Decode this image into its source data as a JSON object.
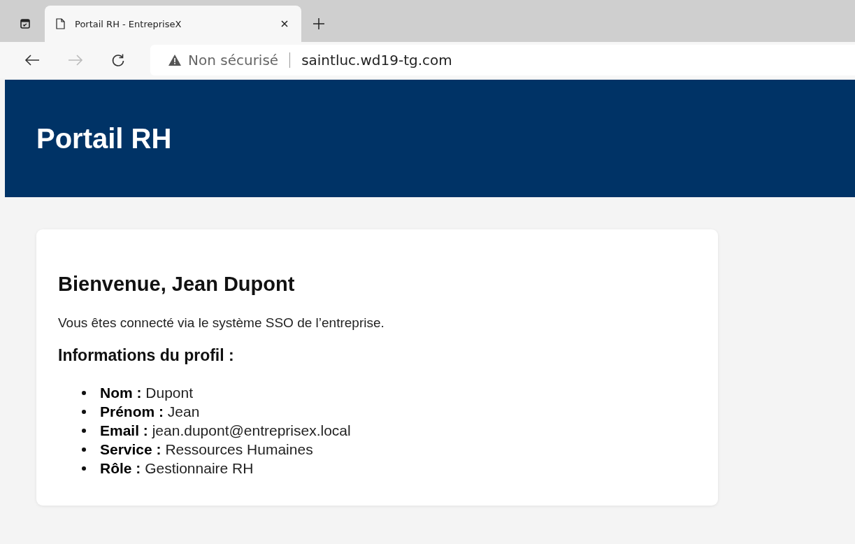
{
  "browser": {
    "tabs": [
      {
        "title": "Portail RH - EntrepriseX",
        "selected": true
      }
    ],
    "address_bar": {
      "security": "Non sécurisé",
      "url": "saintluc.wd19-tg.com"
    },
    "forward_disabled": true
  },
  "header": {
    "title": "Portail RH"
  },
  "card": {
    "heading": "Bienvenue, Jean Dupont",
    "intro": "Vous êtes connecté via le système SSO de l’entreprise.",
    "subheading": "Informations du profil :",
    "fields": [
      "**Nom :** Dupont",
      "**Prénom :** Jean",
      "**Email :** jean.dupont@entreprisex.local",
      "**Service :** Ressources Humaines",
      "**Rôle :** Gestionnaire RH"
    ]
  }
}
